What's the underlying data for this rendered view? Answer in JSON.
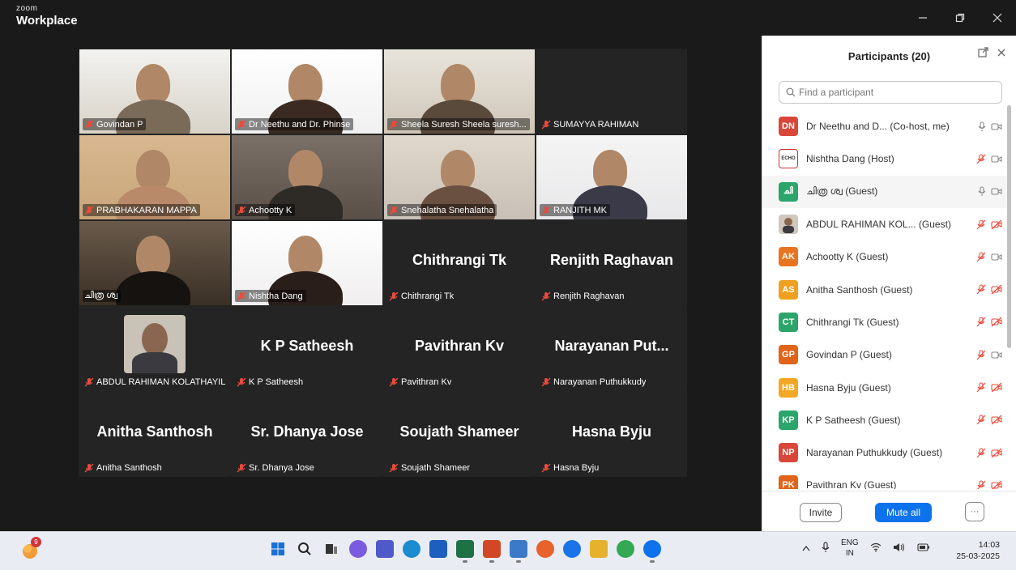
{
  "window": {
    "brand_top": "zoom",
    "brand_main": "Workplace",
    "controls": [
      "minimize-icon",
      "restore-icon",
      "close-icon"
    ]
  },
  "tiles": [
    {
      "name": "Govindan P",
      "big": "",
      "video": true
    },
    {
      "name": "Dr Neethu and Dr. Phinse",
      "big": "",
      "video": true,
      "active": true
    },
    {
      "name": "Sheela Suresh Sheela suresh...",
      "big": "",
      "video": true
    },
    {
      "name": "SUMAYYA RAHIMAN",
      "big": "",
      "video": false
    },
    {
      "name": "PRABHAKARAN MAPPA",
      "big": "",
      "video": true
    },
    {
      "name": "Achootty K",
      "big": "",
      "video": true
    },
    {
      "name": "Snehalatha Snehalatha",
      "big": "",
      "video": true
    },
    {
      "name": "RANJITH MK",
      "big": "",
      "video": true
    },
    {
      "name": "ചിത്ര ശ്വ",
      "big": "",
      "video": true
    },
    {
      "name": "Nishtha Dang",
      "big": "",
      "video": true
    },
    {
      "name": "Chithrangi Tk",
      "big": "Chithrangi Tk",
      "video": false
    },
    {
      "name": "Renjith Raghavan",
      "big": "Renjith Raghavan",
      "video": false
    },
    {
      "name": "ABDUL RAHIMAN KOLATHAYIL",
      "big": "",
      "video": false,
      "photo": true
    },
    {
      "name": "K P Satheesh",
      "big": "K P Satheesh",
      "video": false
    },
    {
      "name": "Pavithran Kv",
      "big": "Pavithran Kv",
      "video": false
    },
    {
      "name": "Narayanan Puthukkudy",
      "big": "Narayanan  Put...",
      "video": false
    },
    {
      "name": "Anitha Santhosh",
      "big": "Anitha Santhosh",
      "video": false
    },
    {
      "name": "Sr. Dhanya Jose",
      "big": "Sr. Dhanya Jose",
      "video": false
    },
    {
      "name": "Soujath Shameer",
      "big": "Soujath Shameer",
      "video": false
    },
    {
      "name": "Hasna Byju",
      "big": "Hasna Byju",
      "video": false
    }
  ],
  "panel": {
    "title": "Participants (20)",
    "search_placeholder": "Find a participant",
    "participants": [
      {
        "initials": "DN",
        "color": "#d9473a",
        "name": "Dr Neethu and D...  (Co-host, me)",
        "muted": false,
        "video": true
      },
      {
        "initials": "ECHO",
        "color": "#ffffff",
        "name": "Nishtha Dang (Host)",
        "muted": true,
        "video": true,
        "logo": true
      },
      {
        "initials": "ചി",
        "color": "#2ca56a",
        "name": "ചിത്ര ശ്വ (Guest)",
        "muted": false,
        "video": true,
        "hl": true
      },
      {
        "initials": "",
        "color": "#8a6d5a",
        "name": "ABDUL RAHIMAN KOL...  (Guest)",
        "muted": true,
        "video": false,
        "photo": true
      },
      {
        "initials": "AK",
        "color": "#e8741f",
        "name": "Achootty K (Guest)",
        "muted": true,
        "video": true
      },
      {
        "initials": "AS",
        "color": "#f0a020",
        "name": "Anitha Santhosh (Guest)",
        "muted": true,
        "video": false
      },
      {
        "initials": "CT",
        "color": "#2ca56a",
        "name": "Chithrangi Tk (Guest)",
        "muted": true,
        "video": false
      },
      {
        "initials": "GP",
        "color": "#e0641a",
        "name": "Govindan P (Guest)",
        "muted": true,
        "video": true
      },
      {
        "initials": "HB",
        "color": "#f2a824",
        "name": "Hasna Byju (Guest)",
        "muted": true,
        "video": false
      },
      {
        "initials": "KP",
        "color": "#2ca56a",
        "name": "K P Satheesh (Guest)",
        "muted": true,
        "video": false
      },
      {
        "initials": "NP",
        "color": "#d9473a",
        "name": "Narayanan Puthukkudy (Guest)",
        "muted": true,
        "video": false
      },
      {
        "initials": "PK",
        "color": "#e0641a",
        "name": "Pavithran Kv (Guest)",
        "muted": true,
        "video": false
      }
    ],
    "invite_label": "Invite",
    "mute_all_label": "Mute all",
    "more_label": "···"
  },
  "taskbar": {
    "notification_count": "9",
    "apps": [
      {
        "icon": "windows-start-icon",
        "color": "#0a64c8"
      },
      {
        "icon": "search-icon",
        "color": "#222"
      },
      {
        "icon": "task-view-icon",
        "color": "#333"
      },
      {
        "icon": "copilot-icon",
        "color": "#7a5ce0"
      },
      {
        "icon": "teams-icon",
        "color": "#5059c9"
      },
      {
        "icon": "edge-icon",
        "color": "#1a8ccf"
      },
      {
        "icon": "store-icon",
        "color": "#1c5fbf"
      },
      {
        "icon": "excel-icon",
        "color": "#1e7145"
      },
      {
        "icon": "powerpoint-icon",
        "color": "#d24726"
      },
      {
        "icon": "notepad-icon",
        "color": "#3c7ac8"
      },
      {
        "icon": "firefox-icon",
        "color": "#e8622b"
      },
      {
        "icon": "chrome-blue-icon",
        "color": "#1a73e8"
      },
      {
        "icon": "file-explorer-icon",
        "color": "#e6b12c"
      },
      {
        "icon": "chrome-icon",
        "color": "#34a853"
      },
      {
        "icon": "zoom-icon",
        "color": "#0e72ed"
      }
    ],
    "lang_line1": "ENG",
    "lang_line2": "IN",
    "time": "14:03",
    "date": "25-03-2025"
  }
}
